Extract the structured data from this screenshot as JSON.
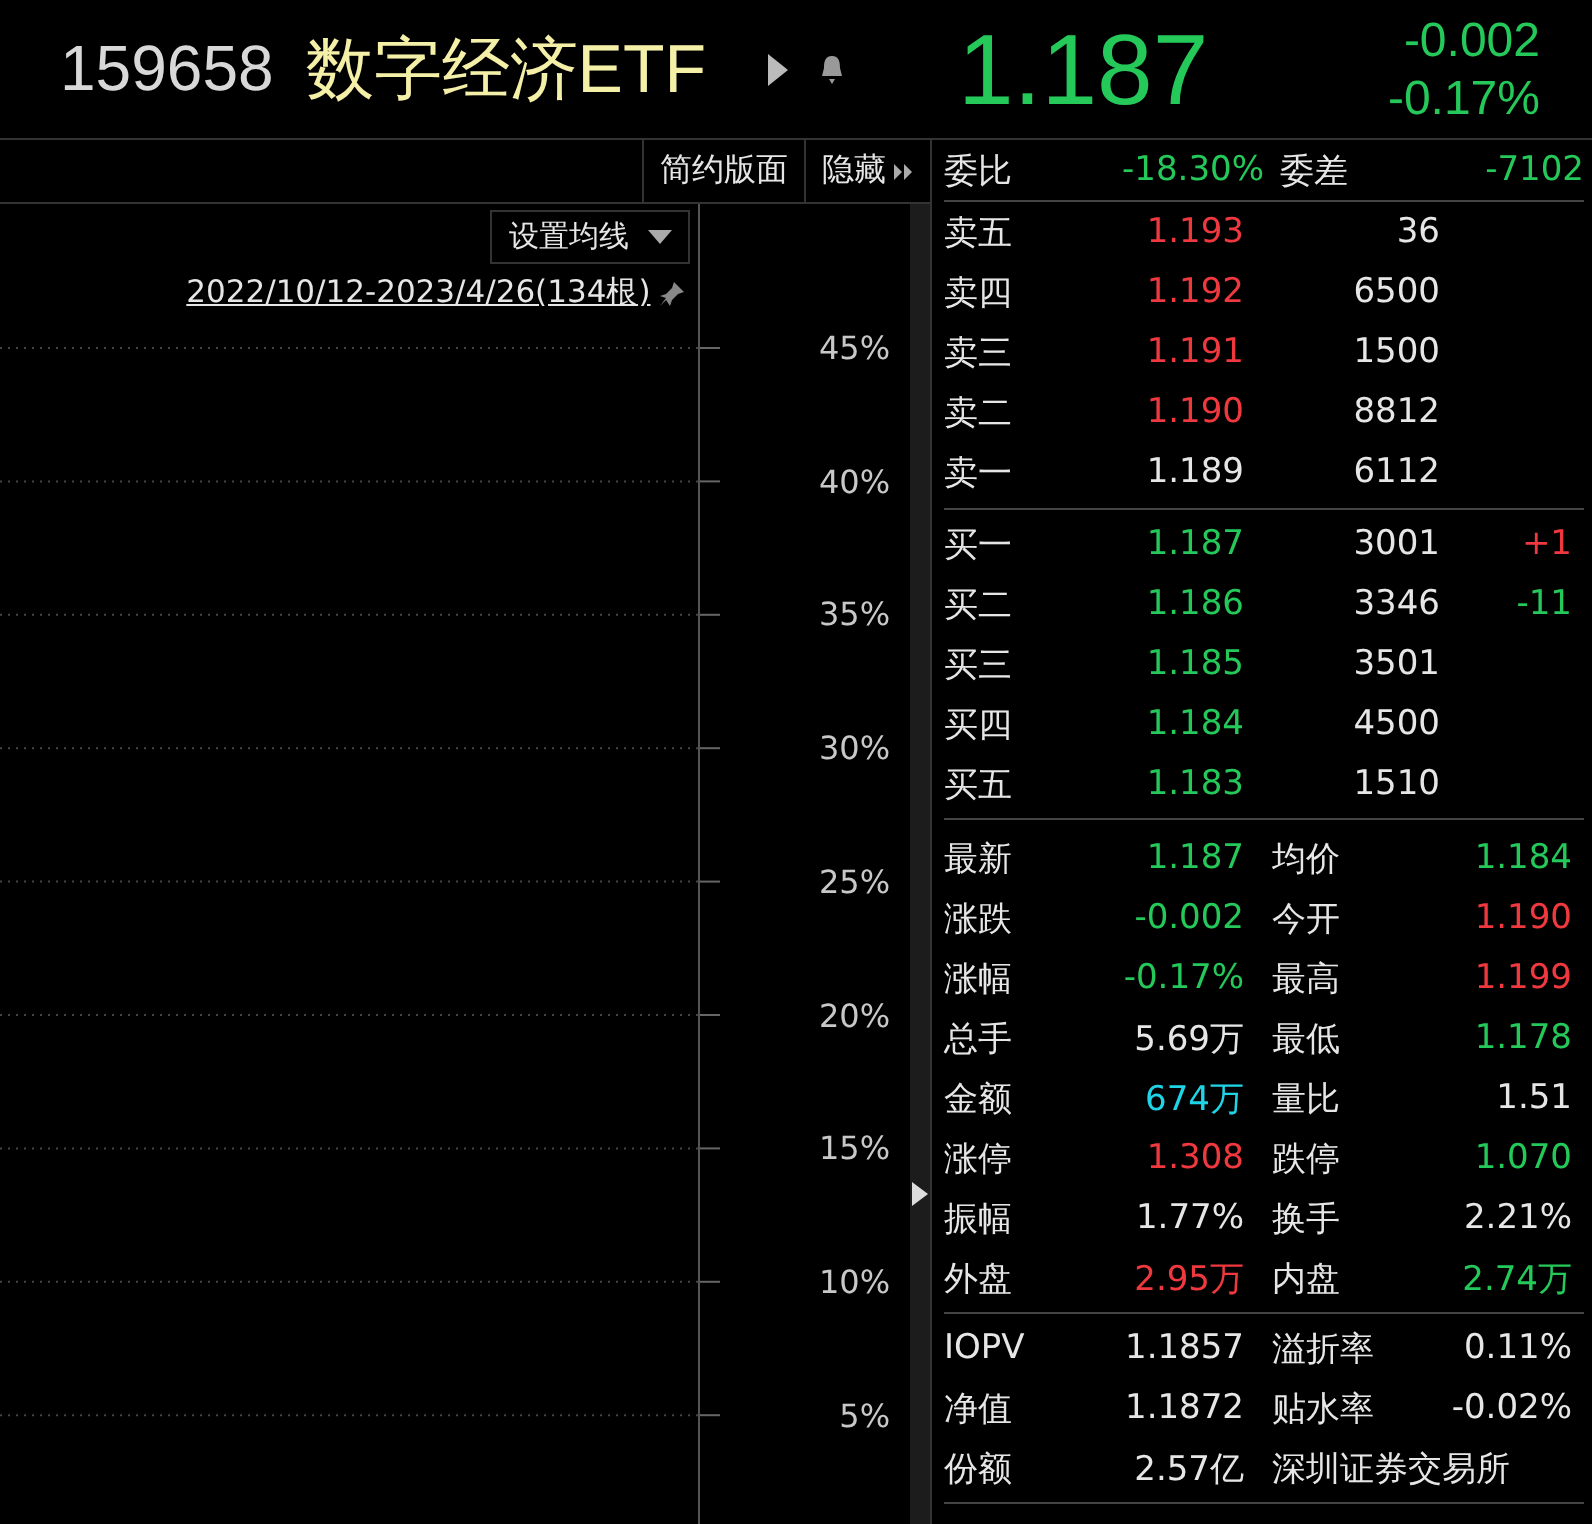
{
  "header": {
    "code": "159658",
    "name": "数字经济ETF",
    "price": "1.187",
    "color": "#25c95a",
    "change": "-0.002",
    "change_pct": "-0.17%"
  },
  "toolbar": {
    "buttons": [
      "简约版面",
      "隐藏"
    ]
  },
  "chart": {
    "ma_button": "设置均线",
    "range_link": "2022/10/12-2023/4/26(134根)",
    "axis_labels": [
      "45%",
      "40%",
      "35%",
      "30%",
      "25%",
      "20%",
      "15%",
      "10%",
      "5%"
    ]
  },
  "summary": [
    {
      "label": "委比",
      "value": {
        "text": "-18.30%",
        "color": "#25c95a"
      }
    },
    {
      "label": "委差",
      "value": {
        "text": "-7102",
        "color": "#25c95a"
      }
    }
  ],
  "asks": [
    {
      "label": "卖五",
      "price": {
        "text": "1.193",
        "color": "#f0383f"
      },
      "volume": "36"
    },
    {
      "label": "卖四",
      "price": {
        "text": "1.192",
        "color": "#f0383f"
      },
      "volume": "6500"
    },
    {
      "label": "卖三",
      "price": {
        "text": "1.191",
        "color": "#f0383f"
      },
      "volume": "1500"
    },
    {
      "label": "卖二",
      "price": {
        "text": "1.190",
        "color": "#f0383f"
      },
      "volume": "8812"
    },
    {
      "label": "卖一",
      "price": {
        "text": "1.189",
        "color": "#e6e6e6"
      },
      "volume": "6112"
    }
  ],
  "bids": [
    {
      "label": "买一",
      "price": {
        "text": "1.187",
        "color": "#25c95a"
      },
      "volume": "3001",
      "delta": {
        "text": "+1",
        "color": "#f0383f"
      }
    },
    {
      "label": "买二",
      "price": {
        "text": "1.186",
        "color": "#25c95a"
      },
      "volume": "3346",
      "delta": {
        "text": "-11",
        "color": "#25c95a"
      }
    },
    {
      "label": "买三",
      "price": {
        "text": "1.185",
        "color": "#25c95a"
      },
      "volume": "3501"
    },
    {
      "label": "买四",
      "price": {
        "text": "1.184",
        "color": "#25c95a"
      },
      "volume": "4500"
    },
    {
      "label": "买五",
      "price": {
        "text": "1.183",
        "color": "#25c95a"
      },
      "volume": "1510"
    }
  ],
  "stats": [
    [
      {
        "label": "最新",
        "value": {
          "text": "1.187",
          "color": "#25c95a"
        }
      },
      {
        "label": "均价",
        "value": {
          "text": "1.184",
          "color": "#25c95a"
        }
      }
    ],
    [
      {
        "label": "涨跌",
        "value": {
          "text": "-0.002",
          "color": "#25c95a"
        }
      },
      {
        "label": "今开",
        "value": {
          "text": "1.190",
          "color": "#f0383f"
        }
      }
    ],
    [
      {
        "label": "涨幅",
        "value": {
          "text": "-0.17%",
          "color": "#25c95a"
        }
      },
      {
        "label": "最高",
        "value": {
          "text": "1.199",
          "color": "#f0383f"
        }
      }
    ],
    [
      {
        "label": "总手",
        "value": {
          "text": "5.69万",
          "color": "#e6e6e6"
        }
      },
      {
        "label": "最低",
        "value": {
          "text": "1.178",
          "color": "#25c95a"
        }
      }
    ],
    [
      {
        "label": "金额",
        "value": {
          "text": "674万",
          "color": "#1fd4e6"
        }
      },
      {
        "label": "量比",
        "value": {
          "text": "1.51",
          "color": "#e6e6e6"
        }
      }
    ],
    [
      {
        "label": "涨停",
        "value": {
          "text": "1.308",
          "color": "#f0383f"
        }
      },
      {
        "label": "跌停",
        "value": {
          "text": "1.070",
          "color": "#25c95a"
        }
      }
    ],
    [
      {
        "label": "振幅",
        "value": {
          "text": "1.77%",
          "color": "#e6e6e6"
        }
      },
      {
        "label": "换手",
        "value": {
          "text": "2.21%",
          "color": "#e6e6e6"
        }
      }
    ],
    [
      {
        "label": "外盘",
        "value": {
          "text": "2.95万",
          "color": "#f0383f"
        }
      },
      {
        "label": "内盘",
        "value": {
          "text": "2.74万",
          "color": "#25c95a"
        }
      }
    ]
  ],
  "fund": [
    {
      "label": "IOPV",
      "value": "1.1857",
      "label2": "溢折率",
      "value2": "0.11%"
    },
    {
      "label": "净值",
      "value": "1.1872",
      "label2": "贴水率",
      "value2": "-0.02%"
    },
    {
      "label": "份额",
      "value": "2.57亿",
      "note": "深圳证券交易所"
    }
  ]
}
